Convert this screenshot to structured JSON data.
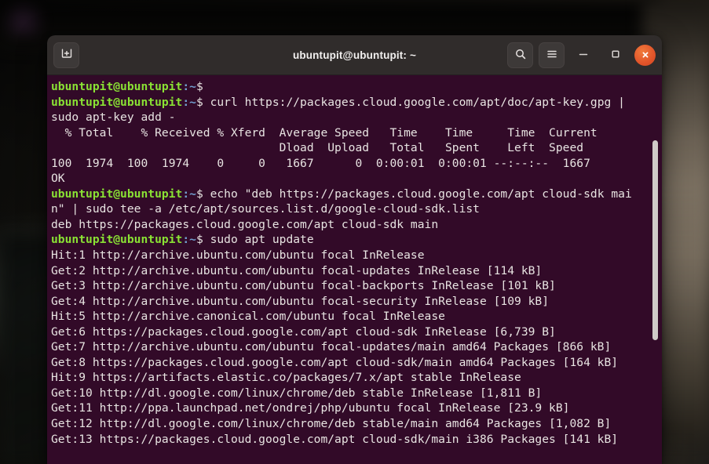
{
  "window": {
    "title": "ubuntupit@ubuntupit: ~",
    "new_tab_icon": "new-tab-plus-icon",
    "search_icon": "search-icon",
    "menu_icon": "hamburger-menu-icon",
    "minimize_icon": "minimize-icon",
    "maximize_icon": "maximize-icon",
    "close_icon": "close-x-icon"
  },
  "colors": {
    "titlebar_bg": "#302c2b",
    "terminal_bg": "#320a28",
    "prompt_user": "#8ae234",
    "prompt_path": "#729fcf",
    "text": "#e8e4e2",
    "close_button": "#e2542a",
    "scrollbar": "#cfcac7"
  },
  "terminal": {
    "prompt_user_host": "ubuntupit@ubuntupit",
    "prompt_path": ":~",
    "prompt_symbol": "$",
    "lines": [
      {
        "type": "prompt",
        "command": ""
      },
      {
        "type": "prompt",
        "command": " curl https://packages.cloud.google.com/apt/doc/apt-key.gpg |"
      },
      {
        "type": "output",
        "text": "sudo apt-key add -"
      },
      {
        "type": "output",
        "text": "  % Total    % Received % Xferd  Average Speed   Time    Time     Time  Current"
      },
      {
        "type": "output",
        "text": "                                 Dload  Upload   Total   Spent    Left  Speed"
      },
      {
        "type": "output",
        "text": "100  1974  100  1974    0     0   1667      0  0:00:01  0:00:01 --:--:--  1667"
      },
      {
        "type": "output",
        "text": "OK"
      },
      {
        "type": "prompt",
        "command": " echo \"deb https://packages.cloud.google.com/apt cloud-sdk mai"
      },
      {
        "type": "output",
        "text": "n\" | sudo tee -a /etc/apt/sources.list.d/google-cloud-sdk.list"
      },
      {
        "type": "output",
        "text": "deb https://packages.cloud.google.com/apt cloud-sdk main"
      },
      {
        "type": "prompt",
        "command": " sudo apt update"
      },
      {
        "type": "output",
        "text": "Hit:1 http://archive.ubuntu.com/ubuntu focal InRelease"
      },
      {
        "type": "output",
        "text": "Get:2 http://archive.ubuntu.com/ubuntu focal-updates InRelease [114 kB]"
      },
      {
        "type": "output",
        "text": "Get:3 http://archive.ubuntu.com/ubuntu focal-backports InRelease [101 kB]"
      },
      {
        "type": "output",
        "text": "Get:4 http://archive.ubuntu.com/ubuntu focal-security InRelease [109 kB]"
      },
      {
        "type": "output",
        "text": "Hit:5 http://archive.canonical.com/ubuntu focal InRelease"
      },
      {
        "type": "output",
        "text": "Get:6 https://packages.cloud.google.com/apt cloud-sdk InRelease [6,739 B]"
      },
      {
        "type": "output",
        "text": "Get:7 http://archive.ubuntu.com/ubuntu focal-updates/main amd64 Packages [866 kB]"
      },
      {
        "type": "output",
        "text": "Get:8 https://packages.cloud.google.com/apt cloud-sdk/main amd64 Packages [164 kB]"
      },
      {
        "type": "output",
        "text": "Hit:9 https://artifacts.elastic.co/packages/7.x/apt stable InRelease"
      },
      {
        "type": "output",
        "text": "Get:10 http://dl.google.com/linux/chrome/deb stable InRelease [1,811 B]"
      },
      {
        "type": "output",
        "text": "Get:11 http://ppa.launchpad.net/ondrej/php/ubuntu focal InRelease [23.9 kB]"
      },
      {
        "type": "output",
        "text": "Get:12 http://dl.google.com/linux/chrome/deb stable/main amd64 Packages [1,082 B]"
      },
      {
        "type": "output",
        "text": "Get:13 https://packages.cloud.google.com/apt cloud-sdk/main i386 Packages [141 kB]"
      }
    ]
  }
}
